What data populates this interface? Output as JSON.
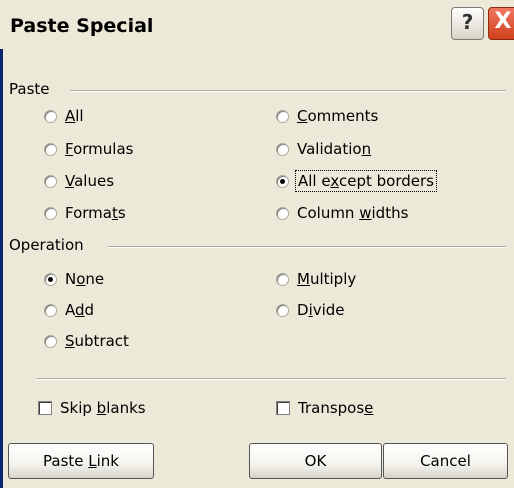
{
  "title": "Paste Special",
  "title_buttons": {
    "help": "?",
    "close": "X"
  },
  "paste": {
    "label": "Paste",
    "options": [
      {
        "pre": "",
        "key": "A",
        "post": "ll",
        "checked": false
      },
      {
        "pre": "",
        "key": "F",
        "post": "ormulas",
        "checked": false
      },
      {
        "pre": "",
        "key": "V",
        "post": "alues",
        "checked": false
      },
      {
        "pre": "Forma",
        "key": "t",
        "post": "s",
        "checked": false
      },
      {
        "pre": "",
        "key": "C",
        "post": "omments",
        "checked": false
      },
      {
        "pre": "Validatio",
        "key": "n",
        "post": "",
        "checked": false
      },
      {
        "pre": "All e",
        "key": "x",
        "post": "cept borders",
        "checked": true
      },
      {
        "pre": "Column ",
        "key": "w",
        "post": "idths",
        "checked": false
      }
    ]
  },
  "operation": {
    "label": "Operation",
    "options": [
      {
        "pre": "N",
        "key": "o",
        "post": "ne",
        "checked": true
      },
      {
        "pre": "A",
        "key": "d",
        "post": "d",
        "checked": false
      },
      {
        "pre": "",
        "key": "S",
        "post": "ubtract",
        "checked": false
      },
      {
        "pre": "",
        "key": "M",
        "post": "ultiply",
        "checked": false
      },
      {
        "pre": "D",
        "key": "i",
        "post": "vide",
        "checked": false
      }
    ]
  },
  "skip_blanks": {
    "pre": "Skip ",
    "key": "b",
    "post": "lanks",
    "checked": false
  },
  "transpose": {
    "pre": "Transpos",
    "key": "e",
    "post": "",
    "checked": false
  },
  "buttons": {
    "paste_link": {
      "pre": "Paste ",
      "key": "L",
      "post": "ink"
    },
    "ok": "OK",
    "cancel": "Cancel"
  }
}
